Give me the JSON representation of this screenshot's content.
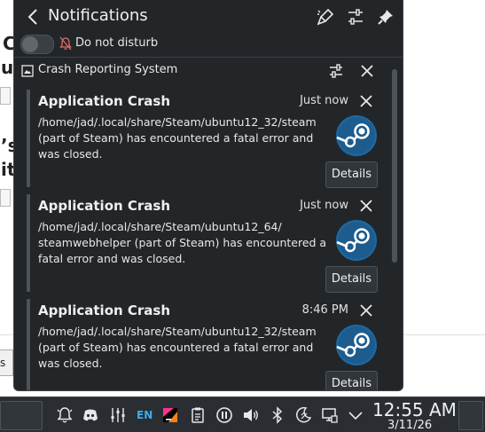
{
  "background": {
    "fragments": [
      "C",
      "up",
      "’s",
      "it"
    ],
    "side_button": "s S"
  },
  "popup": {
    "title": "Notifications",
    "dnd_label": "Do not disturb"
  },
  "group": {
    "label": "Crash Reporting System"
  },
  "notifications": [
    {
      "title": "Application Crash",
      "time": "Just now",
      "body": "/home/jad/.local/share/Steam/ubuntu12_32/steam (part of Steam) has encountered a fatal error and was closed.",
      "details": "Details",
      "icon": "steam-icon"
    },
    {
      "title": "Application Crash",
      "time": "Just now",
      "body": "/home/jad/.local/share/Steam/ubuntu12_64/ steamwebhelper (part of Steam) has encountered a fatal error and was closed.",
      "details": "Details",
      "icon": "steam-icon"
    },
    {
      "title": "Application Crash",
      "time": "8:46 PM",
      "body": "/home/jad/.local/share/Steam/ubuntu12_32/steam (part of Steam) has encountered a fatal error and was closed.",
      "details": "Details",
      "icon": "steam-icon"
    }
  ],
  "taskbar": {
    "lang": "EN",
    "time": "12:55 AM",
    "date": "3/11/26"
  },
  "colors": {
    "panel_bg": "#232629",
    "accent": "#3daee9",
    "steam_blue": "#1b6aa5"
  }
}
